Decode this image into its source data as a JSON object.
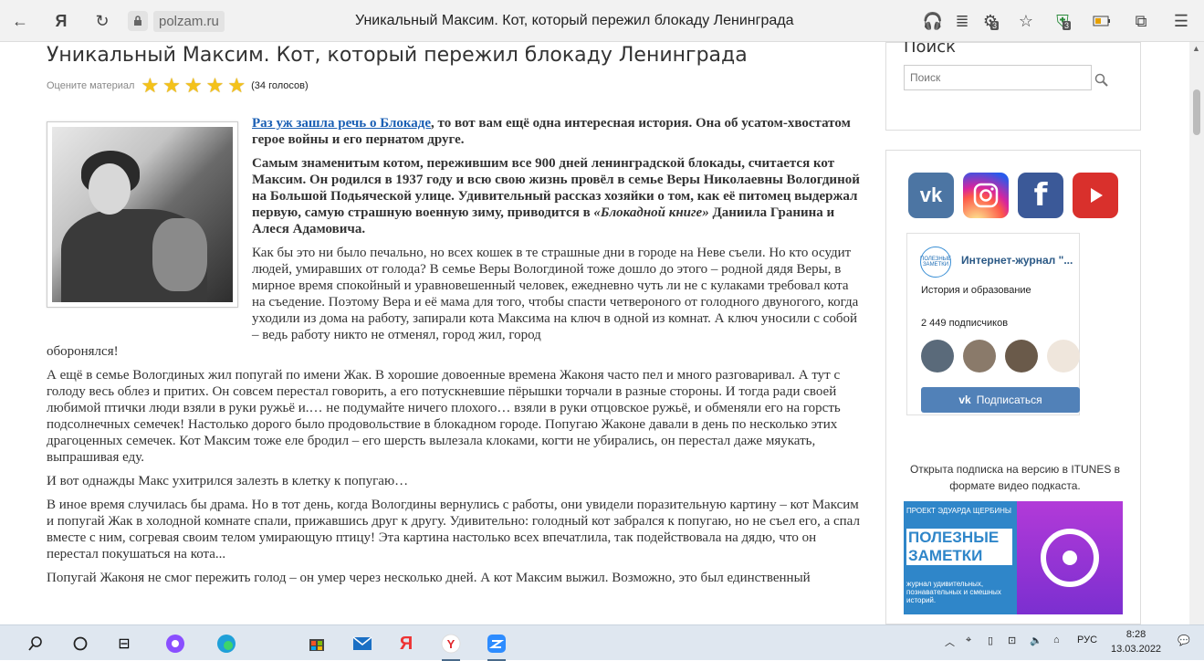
{
  "browser": {
    "domain": "polzam.ru",
    "tab_title": "Уникальный Максим. Кот, который пережил блокаду Ленинграда",
    "badge_count_1": "3",
    "badge_count_2": "3"
  },
  "article": {
    "title": "Уникальный Максим. Кот, который пережил блокаду Ленинграда",
    "rate_label": "Оцените материал",
    "votes": "(34 голосов)",
    "link_text": "Раз уж зашла речь о Блокаде",
    "intro_rest": ", то вот вам ещё одна интересная история. Она об усатом-хвостатом герое войны и его пернатом друге.",
    "lead_bold_1": "Самым знаменитым котом, пережившим все 900 дней ленинградской блокады, считается кот Максим. Он родился в 1937 году и всю свою жизнь провёл в семье Веры Николаевны Вологдиной на Большой Подьяческой улице. Удивительный рассказ хозяйки о том, как её питомец выдержал первую, самую страшную военную зиму, приводится в ",
    "lead_italic": "«Блокадной книге»",
    "lead_bold_2": " Даниила Гранина и Алеся Адамовича.",
    "para_1": "Как бы это ни было печально, но всех кошек в те страшные дни в городе на Неве съели. Но кто осудит людей, умиравших от голода? В семье Веры Вологдиной тоже дошло до этого – родной дядя Веры, в мирное время спокойный и уравновешенный человек, ежедневно чуть ли не с кулаками требовал кота на съедение. Поэтому Вера и её мама для того, чтобы спасти четвероного от голодного двуногого, когда уходили из дома на работу, запирали кота Максима на ключ в одной из комнат. А ключ уносили с собой – ведь работу никто не отменял, город жил, город",
    "para_1_end": "оборонялся!",
    "para_2": "А ещё в семье Вологдиных жил попугай по имени Жак. В хорошие довоенные времена Жаконя часто пел и много разговаривал. А тут с голоду весь облез и притих. Он совсем перестал говорить, а его потускневшие пёрышки торчали в разные стороны. И тогда ради своей любимой птички люди взяли в руки ружьё и.… не подумайте ничего плохого… взяли в руки отцовское ружьё, и обменяли его на горсть подсолнечных семечек! Настолько дорого было продовольствие в блокадном городе. Попугаю Жаконе давали в день по несколько этих драгоценных семечек. Кот Максим тоже еле бродил – его шерсть вылезала клоками, когти не убирались, он перестал даже мяукать, выпрашивая еду.",
    "para_3": "И вот однажды Макс ухитрился залезть в клетку к попугаю…",
    "para_4": "В иное время случилась бы драма. Но в тот день, когда Вологдины вернулись с работы, они увидели поразительную картину – кот Максим и попугай Жак в холодной комнате спали, прижавшись друг к другу. Удивительно: голодный кот забрался к попугаю, но не съел его, а спал вместе с ним, согревая своим телом умирающую птицу! Эта картина настолько всех впечатлила, так подействовала на дядю, что он перестал покушаться на кота...",
    "para_5": "Попугай Жаконя не смог пережить голод – он умер через несколько дней. А кот Максим выжил. Возможно, это был единственный"
  },
  "sidebar": {
    "search_title": "Поиск",
    "search_placeholder": "Поиск",
    "vk_group_name": "Интернет-журнал \"...",
    "vk_group_avatar_text": "ПОЛЕЗНЫЕ ЗАМЕТКИ",
    "vk_category": "История и образование",
    "vk_subscribers": "2 449 подписчиков",
    "vk_button": "Подписаться",
    "itunes_text": "Открыта подписка на версию в ITUNES  в формате видео подкаста.",
    "promo_top": "ПРОЕКТ ЭДУАРДА ЩЕРБИНЫ",
    "promo_title": "ПОЛЕЗНЫЕ ЗАМЕТКИ",
    "promo_sub": "журнал удивительных, познавательных и смешных историй."
  },
  "taskbar": {
    "lang": "РУС",
    "time": "8:28",
    "date": "13.03.2022"
  }
}
